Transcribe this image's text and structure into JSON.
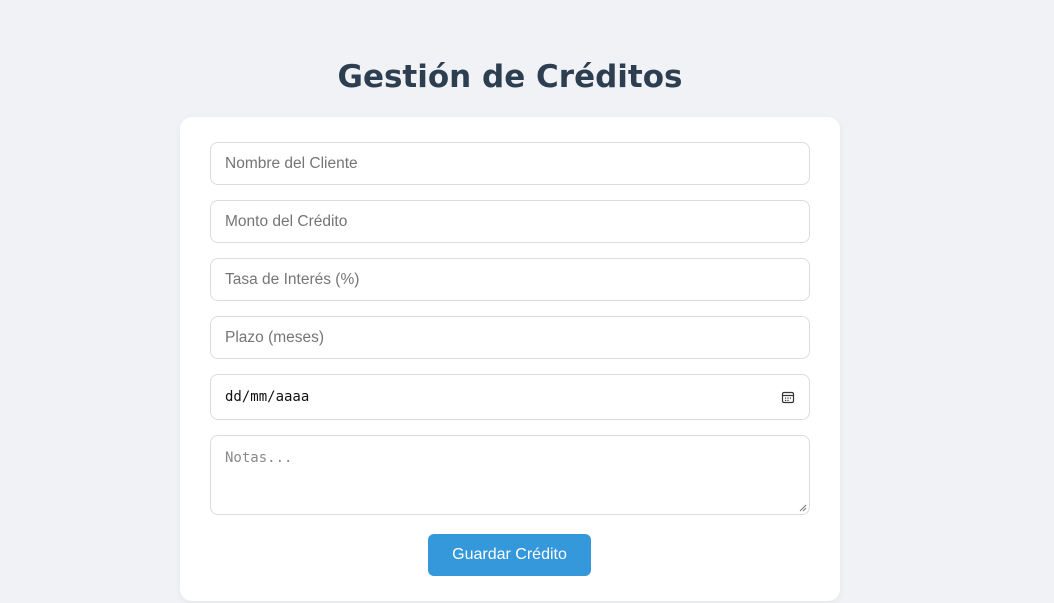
{
  "page": {
    "title": "Gestión de Créditos"
  },
  "form": {
    "client_name_placeholder": "Nombre del Cliente",
    "amount_placeholder": "Monto del Crédito",
    "interest_placeholder": "Tasa de Interés (%)",
    "term_placeholder": "Plazo (meses)",
    "date_placeholder": "dd/mm/aaaa",
    "notes_placeholder": "Notas...",
    "save_label": "Guardar Crédito"
  },
  "icons": {
    "date_field_icon": "calendar-icon"
  },
  "colors": {
    "background": "#f0f2f5",
    "title": "#2c3e50",
    "card": "#ffffff",
    "accent": "#3498db"
  }
}
